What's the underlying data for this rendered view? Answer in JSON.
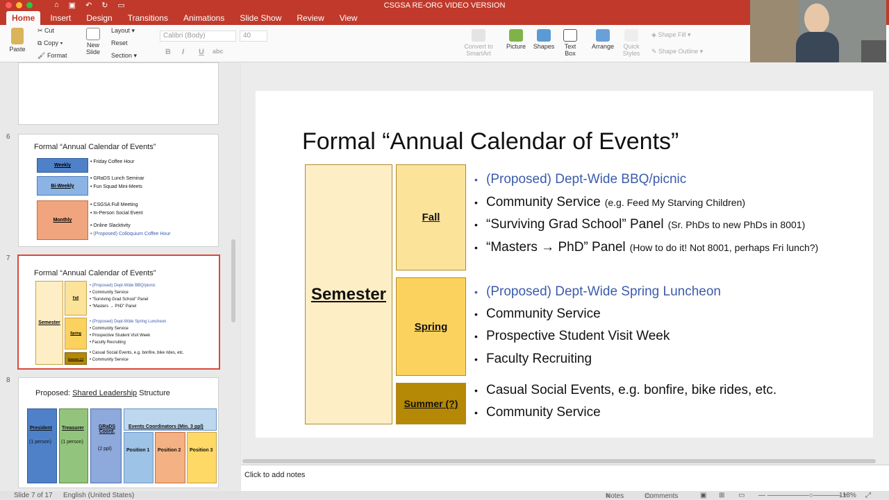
{
  "window": {
    "title": "CSGSA RE-ORG VIDEO VERSION"
  },
  "tabs": [
    "Home",
    "Insert",
    "Design",
    "Transitions",
    "Animations",
    "Slide Show",
    "Review",
    "View"
  ],
  "ribbon": {
    "paste": "Paste",
    "cut": "Cut",
    "copy": "Copy",
    "format": "Format",
    "new_slide": "New Slide",
    "layout": "Layout",
    "reset": "Reset",
    "section": "Section",
    "font": "Calibri (Body)",
    "size": "40",
    "convert": "Convert to SmartArt",
    "picture": "Picture",
    "shapes": "Shapes",
    "text_box": "Text Box",
    "arrange": "Arrange",
    "quick_styles": "Quick Styles",
    "shape_fill": "Shape Fill",
    "shape_outline": "Shape Outline"
  },
  "thumbs": {
    "n6": "6",
    "n7": "7",
    "n8": "8",
    "t6": {
      "title": "Formal “Annual Calendar of Events”",
      "weekly": "Weekly",
      "biweekly": "Bi-Weekly",
      "monthly": "Monthly",
      "l1": "• Friday Coffee Hour",
      "l2": "• GRaDS Lunch Seminar",
      "l3": "• Fun Squad Mini-Meets",
      "l4": "• CSGSA Full Meeting",
      "l5": "• In-Person Social Event",
      "l6": "• Online Slacktivity",
      "l7": "• (Proposed) Colloquium Coffee Hour"
    },
    "t7": {
      "title": "Formal “Annual Calendar of Events”",
      "semester": "Semester",
      "fall": "Fall",
      "spring": "Spring",
      "summer": "Summer (?)",
      "l1": "• (Proposed) Dept-Wide BBQ/picnic",
      "l2": "• Community Service",
      "l3": "• “Surviving Grad School” Panel",
      "l4": "• “Masters → PhD” Panel",
      "l5": "• (Proposed) Dept-Wide Spring Luncheon",
      "l6": "• Community Service",
      "l7": "• Prospective Student Visit Week",
      "l8": "• Faculty Recruiting",
      "l9": "• Casual Social Events, e.g. bonfire, bike rides, etc.",
      "l10": "• Community Service"
    },
    "t8": {
      "title_a": "Proposed: ",
      "title_b": "Shared Leadership",
      "title_c": " Structure",
      "president": "President",
      "p_sub": "(1 person)",
      "treasurer": "Treasurer",
      "t_sub": "(1 person)",
      "grads": "GRaDS Coord.",
      "g_sub": "(2 ppl)",
      "events": "Events Coordinators (Min. 3 ppl)",
      "pos1": "Position 1",
      "pos2": "Position 2",
      "pos3": "Position 3"
    }
  },
  "slide": {
    "title": "Formal “Annual Calendar of Events”",
    "semester": "Semester",
    "fall": "Fall",
    "spring": "Spring",
    "summer": "Summer (?)",
    "fall_items": [
      {
        "text": "(Proposed) Dept-Wide BBQ/picnic",
        "note": ""
      },
      {
        "text": "Community Service",
        "note": "(e.g. Feed My Starving Children)"
      },
      {
        "text": "“Surviving Grad School” Panel",
        "note": "(Sr. PhDs to new PhDs in 8001)"
      },
      {
        "text": "“Masters → PhD” Panel",
        "note": "(How to do it! Not 8001, perhaps Fri lunch?)"
      }
    ],
    "spring_items": [
      "(Proposed) Dept-Wide Spring Luncheon",
      "Community Service",
      "Prospective Student Visit Week",
      "Faculty Recruiting"
    ],
    "summer_items": [
      "Casual Social Events, e.g. bonfire, bike rides, etc.",
      "Community Service"
    ]
  },
  "notes_placeholder": "Click to add notes",
  "status": {
    "slide": "Slide 7 of 17",
    "lang": "English (United States)",
    "notes": "Notes",
    "comments": "Comments",
    "zoom": "118%"
  },
  "colors": {
    "accent": "#c0392b",
    "fall": "#fbe39a",
    "spring": "#fcd25e",
    "summer": "#b58806",
    "semester": "#fdeec5"
  }
}
